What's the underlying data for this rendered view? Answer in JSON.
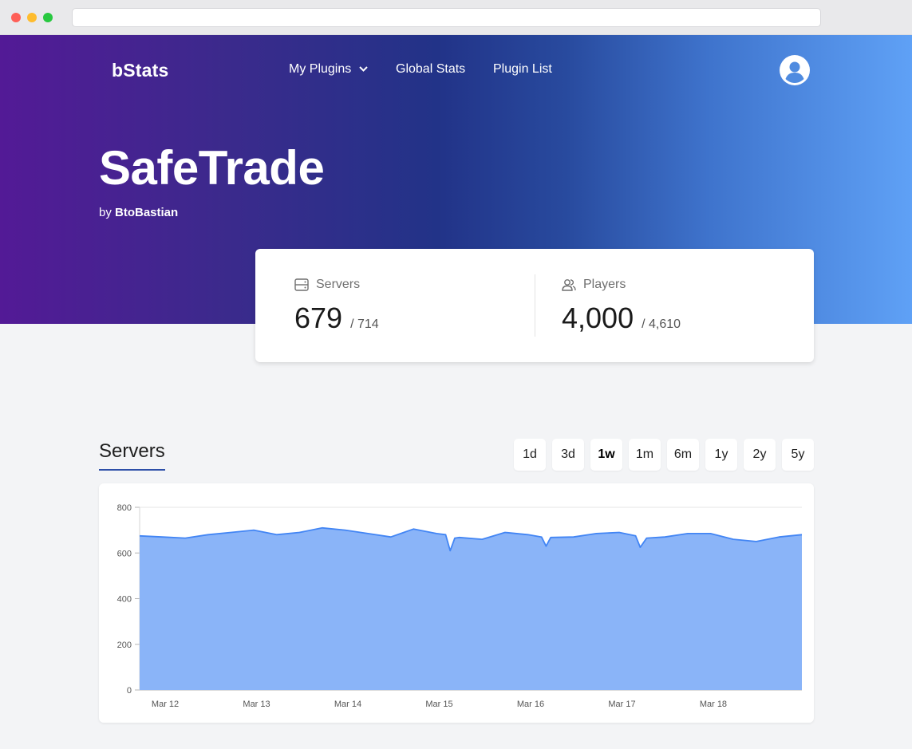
{
  "nav": {
    "brand": "bStats",
    "items": [
      "My Plugins",
      "Global Stats",
      "Plugin List"
    ]
  },
  "plugin": {
    "name": "SafeTrade",
    "by_prefix": "by",
    "author": "BtoBastian"
  },
  "stats": {
    "servers": {
      "label": "Servers",
      "value": "679",
      "max": "/ 714"
    },
    "players": {
      "label": "Players",
      "value": "4,000",
      "max": "/ 4,610"
    }
  },
  "chart_section": {
    "title": "Servers",
    "ranges": [
      "1d",
      "3d",
      "1w",
      "1m",
      "6m",
      "1y",
      "2y",
      "5y"
    ],
    "active_range": "1w"
  },
  "colors": {
    "gradient_start": "#531a96",
    "gradient_end": "#5fa1f6",
    "area_fill": "#8ab4f8",
    "line": "#4285f4",
    "title_underline": "#2d4fa8"
  },
  "chart_data": {
    "type": "area",
    "title": "",
    "xlabel": "",
    "ylabel": "",
    "ylim": [
      0,
      800
    ],
    "yticks": [
      0,
      200,
      400,
      600,
      800
    ],
    "x_tick_labels": [
      "Mar 12",
      "Mar 13",
      "Mar 14",
      "Mar 15",
      "Mar 16",
      "Mar 17",
      "Mar 18"
    ],
    "x_tick_positions_days": [
      0.28,
      1.28,
      2.28,
      3.28,
      4.28,
      5.28,
      6.28
    ],
    "x_range_days": [
      0,
      7.25
    ],
    "grid": true,
    "series": [
      {
        "name": "",
        "x_days": [
          0.0,
          0.25,
          0.5,
          0.75,
          1.0,
          1.25,
          1.5,
          1.75,
          2.0,
          2.25,
          2.5,
          2.75,
          3.0,
          3.25,
          3.35,
          3.4,
          3.45,
          3.5,
          3.75,
          4.0,
          4.25,
          4.4,
          4.45,
          4.5,
          4.75,
          5.0,
          5.25,
          5.43,
          5.48,
          5.55,
          5.75,
          6.0,
          6.25,
          6.5,
          6.75,
          7.0,
          7.25
        ],
        "values": [
          675,
          670,
          665,
          680,
          690,
          700,
          680,
          690,
          710,
          700,
          685,
          670,
          705,
          685,
          680,
          610,
          665,
          668,
          660,
          690,
          680,
          670,
          630,
          668,
          670,
          685,
          690,
          675,
          625,
          665,
          670,
          685,
          685,
          660,
          650,
          670,
          680
        ]
      }
    ]
  }
}
